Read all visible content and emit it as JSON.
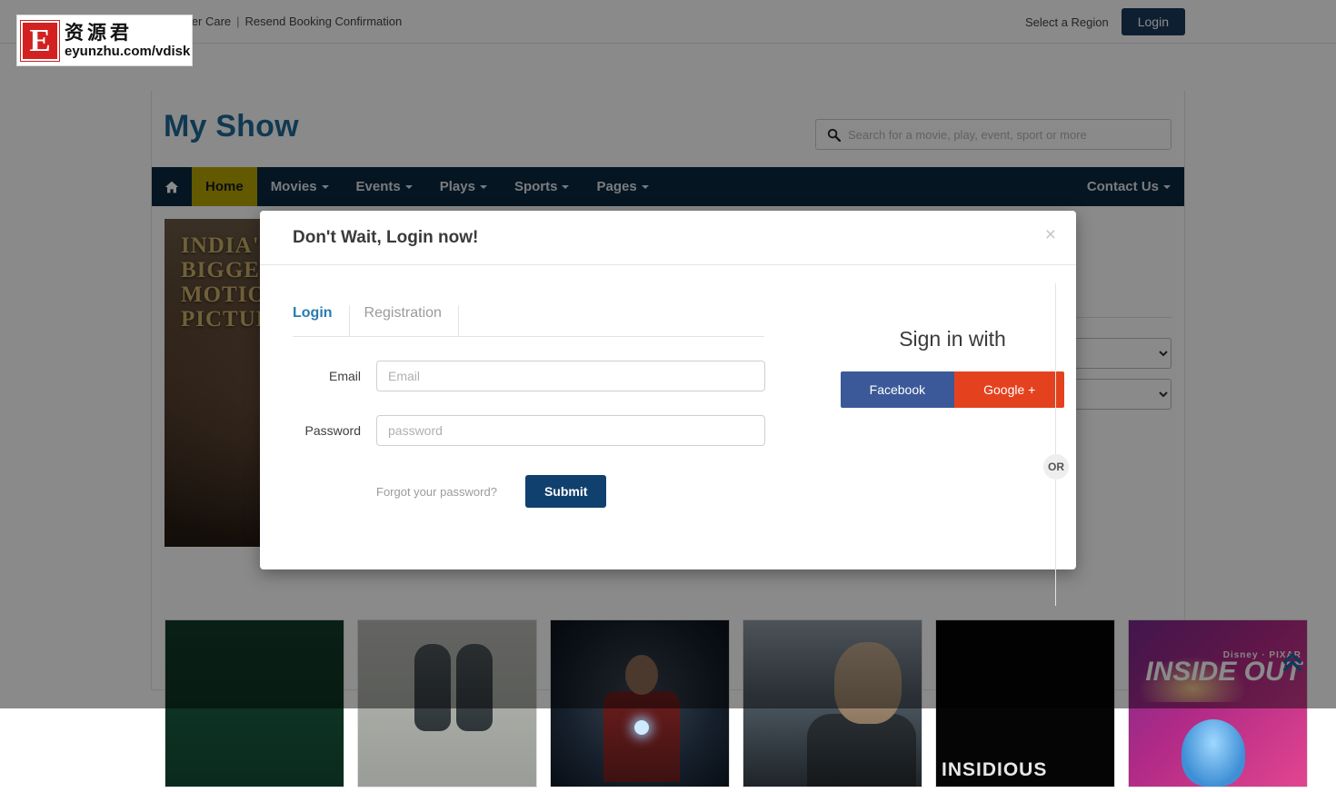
{
  "topbar": {
    "links": [
      {
        "label": "Customer Care"
      },
      {
        "label": "Resend Booking Confirmation"
      }
    ],
    "separator": "|",
    "region_label": "Select a Region",
    "login_label": "Login"
  },
  "header": {
    "brand": "My Show",
    "search": {
      "placeholder": "Search for a movie, play, event, sport or more",
      "value": "",
      "icon": "search-icon"
    }
  },
  "nav": {
    "home_icon": "home-icon",
    "items": [
      {
        "label": "Home",
        "has_caret": false,
        "active": true
      },
      {
        "label": "Movies",
        "has_caret": true,
        "active": false
      },
      {
        "label": "Events",
        "has_caret": true,
        "active": false
      },
      {
        "label": "Plays",
        "has_caret": true,
        "active": false
      },
      {
        "label": "Sports",
        "has_caret": true,
        "active": false
      },
      {
        "label": "Pages",
        "has_caret": true,
        "active": false
      }
    ],
    "right_item": {
      "label": "Contact Us",
      "has_caret": true
    }
  },
  "hero": {
    "tagline": "INDIA'S\nBIGGEST\nMOTION\nPICTURE"
  },
  "side_panel": {
    "selects": [
      {
        "value": ""
      },
      {
        "value": ""
      }
    ]
  },
  "thumbnails": [
    {
      "name": "thumb-green",
      "title": ""
    },
    {
      "name": "thumb-feet",
      "title": ""
    },
    {
      "name": "thumb-ironman",
      "title": ""
    },
    {
      "name": "thumb-terminator",
      "title": ""
    },
    {
      "name": "thumb-insidious",
      "title": "INSIDIOUS"
    },
    {
      "name": "thumb-inside-out",
      "title": "INSIDE OUT",
      "studio": "Disney · PIXAR"
    }
  ],
  "scroll_top": {
    "icon": "chevron-double-up-icon"
  },
  "modal": {
    "title": "Don't Wait, Login now!",
    "close_label": "×",
    "tabs": [
      {
        "label": "Login",
        "active": true
      },
      {
        "label": "Registration",
        "active": false
      }
    ],
    "form": {
      "email": {
        "label": "Email",
        "placeholder": "Email",
        "value": ""
      },
      "password": {
        "label": "Password",
        "placeholder": "password",
        "value": ""
      },
      "forgot_label": "Forgot your password?",
      "submit_label": "Submit"
    },
    "or_label": "OR",
    "social": {
      "title": "Sign in with",
      "facebook_label": "Facebook",
      "google_label": "Google +"
    }
  },
  "watermark": {
    "letter": "E",
    "chinese": "资源君",
    "url": "eyunzhu.com/vdisk"
  },
  "colors": {
    "nav_bg": "#0b2740",
    "nav_active": "#b5a400",
    "brand": "#1f6a96",
    "primary_button": "#10406e",
    "facebook": "#3b5998",
    "google": "#e4421f",
    "tab_active": "#2a7ab0"
  }
}
